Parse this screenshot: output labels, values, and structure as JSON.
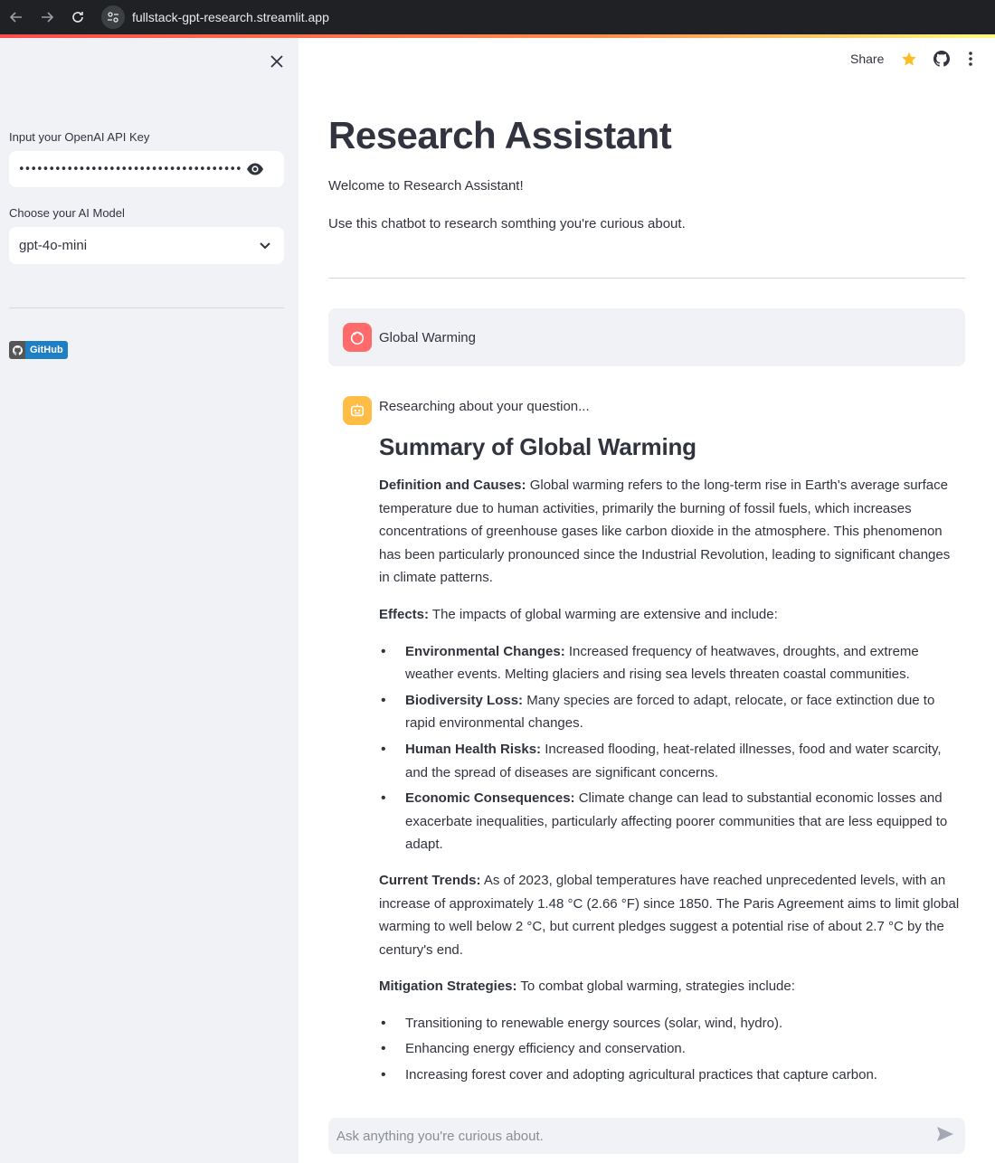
{
  "browser": {
    "url": "fullstack-gpt-research.streamlit.app"
  },
  "sidebar": {
    "api_key_label": "Input your OpenAI API Key",
    "api_key_value": "••••••••••••••••••••••••••••••••••••••••••••••••••••",
    "model_label": "Choose your AI Model",
    "model_value": "gpt-4o-mini",
    "github_badge": "GitHub"
  },
  "toolbar": {
    "share_label": "Share"
  },
  "main": {
    "title": "Research Assistant",
    "welcome": "Welcome to Research Assistant!",
    "description": "Use this chatbot to research somthing you're curious about."
  },
  "chat": {
    "user_message": "Global Warming",
    "bot_status": "Researching about your question...",
    "summary_heading": "Summary of Global Warming",
    "definition_label": "Definition and Causes:",
    "definition_text": " Global warming refers to the long-term rise in Earth's average surface temperature due to human activities, primarily the burning of fossil fuels, which increases concentrations of greenhouse gases like carbon dioxide in the atmosphere. This phenomenon has been particularly pronounced since the Industrial Revolution, leading to significant changes in climate patterns.",
    "effects_label": "Effects:",
    "effects_text": " The impacts of global warming are extensive and include:",
    "effects": [
      {
        "label": "Environmental Changes:",
        "text": " Increased frequency of heatwaves, droughts, and extreme weather events. Melting glaciers and rising sea levels threaten coastal communities."
      },
      {
        "label": "Biodiversity Loss:",
        "text": " Many species are forced to adapt, relocate, or face extinction due to rapid environmental changes."
      },
      {
        "label": "Human Health Risks:",
        "text": " Increased flooding, heat-related illnesses, food and water scarcity, and the spread of diseases are significant concerns."
      },
      {
        "label": "Economic Consequences:",
        "text": " Climate change can lead to substantial economic losses and exacerbate inequalities, particularly affecting poorer communities that are less equipped to adapt."
      }
    ],
    "trends_label": "Current Trends:",
    "trends_text": " As of 2023, global temperatures have reached unprecedented levels, with an increase of approximately 1.48 °C (2.66 °F) since 1850. The Paris Agreement aims to limit global warming to well below 2 °C, but current pledges suggest a potential rise of about 2.7 °C by the century's end.",
    "mitigation_label": "Mitigation Strategies:",
    "mitigation_text": " To combat global warming, strategies include:",
    "mitigation": [
      "Transitioning to renewable energy sources (solar, wind, hydro).",
      "Enhancing energy efficiency and conservation.",
      "Increasing forest cover and adopting agricultural practices that capture carbon."
    ],
    "input_placeholder": "Ask anything you're curious about."
  }
}
